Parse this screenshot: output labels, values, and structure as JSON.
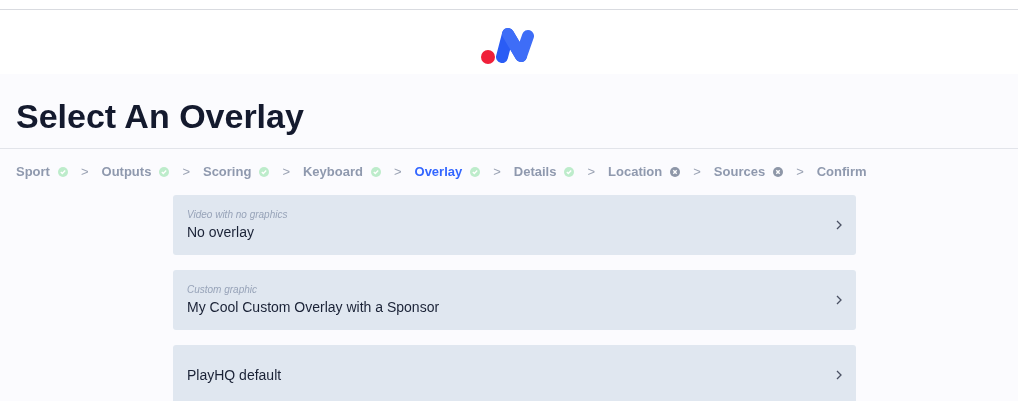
{
  "title": "Select An Overlay",
  "steps": [
    {
      "label": "Sport",
      "complete": true,
      "selected": false
    },
    {
      "label": "Outputs",
      "complete": true,
      "selected": false
    },
    {
      "label": "Scoring",
      "complete": true,
      "selected": false
    },
    {
      "label": "Keyboard",
      "complete": true,
      "selected": false
    },
    {
      "label": "Overlay",
      "complete": true,
      "selected": true
    },
    {
      "label": "Details",
      "complete": true,
      "selected": false
    },
    {
      "label": "Location",
      "complete": false,
      "selected": false
    },
    {
      "label": "Sources",
      "complete": false,
      "selected": false
    },
    {
      "label": "Confirm",
      "selected": false
    }
  ],
  "separator": ">",
  "options": [
    {
      "caption": "Video with no graphics",
      "name": "No overlay"
    },
    {
      "caption": "Custom graphic",
      "name": "My Cool Custom Overlay with a Sponsor"
    },
    {
      "name": "PlayHQ default"
    }
  ]
}
